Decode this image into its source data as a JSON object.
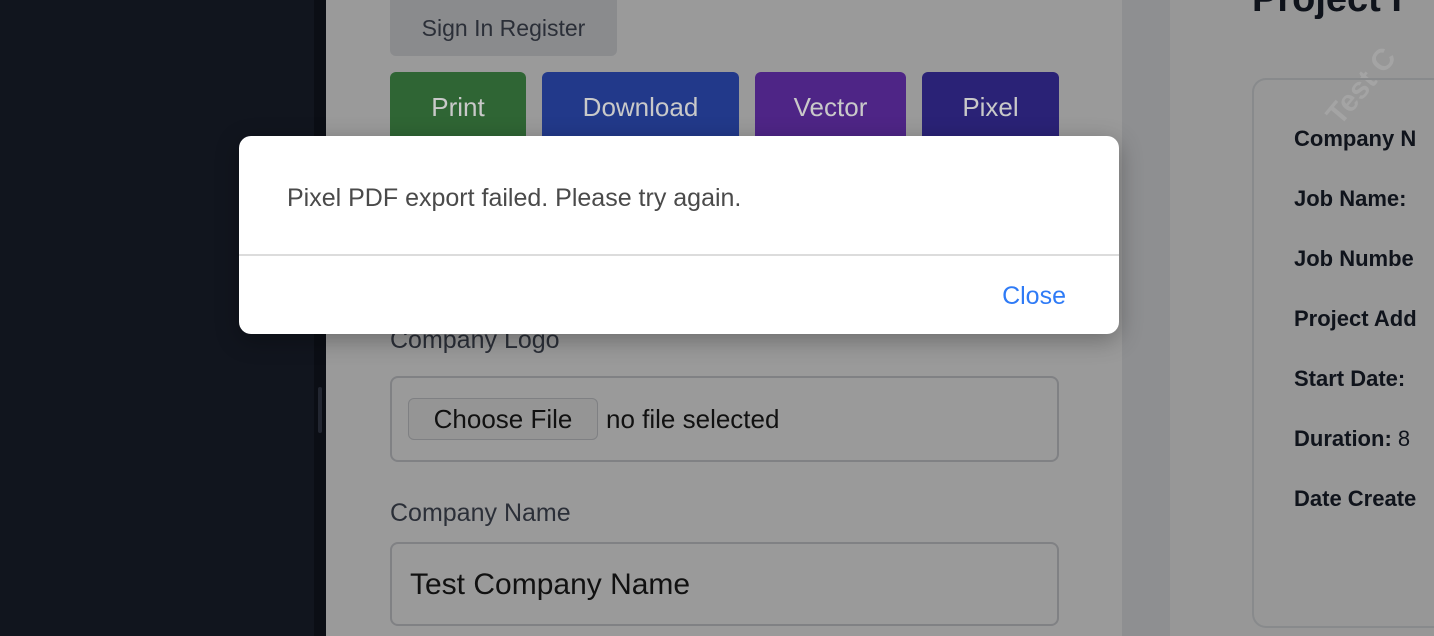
{
  "main": {
    "signin_label": "Sign In Register",
    "buttons": {
      "print": "Print",
      "download": "Download",
      "vector": "Vector",
      "pixel": "Pixel"
    },
    "logo_label": "Company Logo",
    "choose_file": "Choose File",
    "no_file": "no file selected",
    "company_name_label": "Company Name",
    "company_name_value": "Test Company Name"
  },
  "preview": {
    "title": "Project I",
    "watermark": "Test C",
    "rows": [
      {
        "label": "Company N",
        "value": ""
      },
      {
        "label": "Job Name:",
        "value": ""
      },
      {
        "label": "Job Numbe",
        "value": ""
      },
      {
        "label": "Project Add",
        "value": ""
      },
      {
        "label": "Start Date:",
        "value": ""
      },
      {
        "label": "Duration:",
        "value": " 8"
      },
      {
        "label": "Date Create",
        "value": ""
      }
    ]
  },
  "modal": {
    "message": "Pixel PDF export failed. Please try again.",
    "close_label": "Close"
  },
  "colors": {
    "accent": "#2f7bf6",
    "print": "#3e8a46",
    "download": "#2c4fb0",
    "vector": "#6b2fb0",
    "pixel": "#33289a"
  }
}
